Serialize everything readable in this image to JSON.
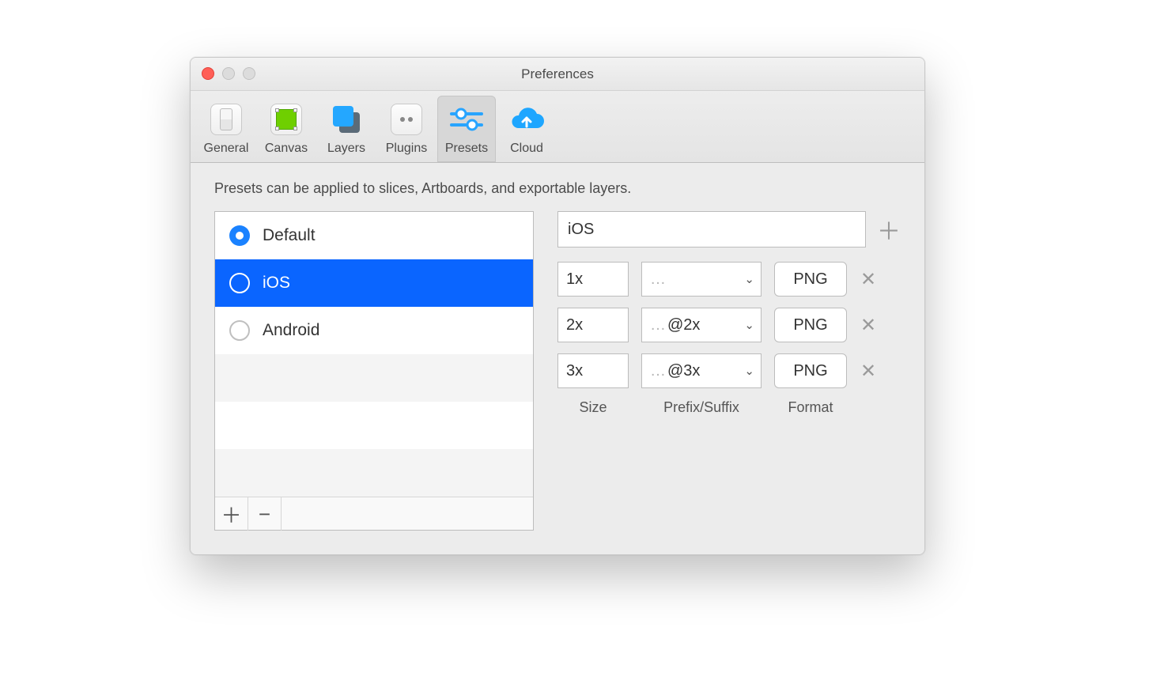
{
  "window_title": "Preferences",
  "tabs": {
    "general": "General",
    "canvas": "Canvas",
    "layers": "Layers",
    "plugins": "Plugins",
    "presets": "Presets",
    "cloud": "Cloud"
  },
  "description": "Presets can be applied to slices, Artboards, and exportable layers.",
  "presets": [
    {
      "name": "Default",
      "default": true,
      "selected": false
    },
    {
      "name": "iOS",
      "default": false,
      "selected": true
    },
    {
      "name": "Android",
      "default": false,
      "selected": false
    }
  ],
  "selected_preset_name": "iOS",
  "export_rows": [
    {
      "size": "1x",
      "suffix": "",
      "format": "PNG"
    },
    {
      "size": "2x",
      "suffix": "@2x",
      "format": "PNG"
    },
    {
      "size": "3x",
      "suffix": "@3x",
      "format": "PNG"
    }
  ],
  "column_labels": {
    "size": "Size",
    "prefix_suffix": "Prefix/Suffix",
    "format": "Format"
  },
  "glyphs": {
    "dots": "…",
    "plus": "＋",
    "minus": "−",
    "close": "✕",
    "caret": "⌄"
  }
}
